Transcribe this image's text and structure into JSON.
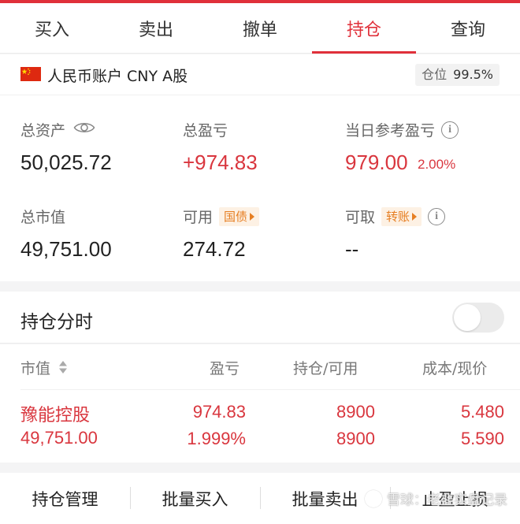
{
  "tabs": [
    {
      "label": "买入",
      "active": false
    },
    {
      "label": "卖出",
      "active": false
    },
    {
      "label": "撤单",
      "active": false
    },
    {
      "label": "持仓",
      "active": true
    },
    {
      "label": "查询",
      "active": false
    }
  ],
  "account": {
    "flag_icon": "china-flag-icon",
    "title": "人民币账户 CNY A股",
    "position_label": "仓位",
    "position_value": "99.5%"
  },
  "metrics": {
    "total_assets_label": "总资产",
    "total_assets_value": "50,025.72",
    "total_pnl_label": "总盈亏",
    "total_pnl_value": "+974.83",
    "daily_pnl_label": "当日参考盈亏",
    "daily_pnl_value": "979.00",
    "daily_pnl_pct": "2.00%",
    "market_value_label": "总市值",
    "market_value_value": "49,751.00",
    "available_label": "可用",
    "available_tag": "国债",
    "available_value": "274.72",
    "withdrawable_label": "可取",
    "withdrawable_tag": "转账",
    "withdrawable_value": "--"
  },
  "time_share": {
    "label": "持仓分时",
    "enabled": false
  },
  "table": {
    "headers": [
      "市值",
      "盈亏",
      "持仓/可用",
      "成本/现价"
    ],
    "rows": [
      {
        "name": "豫能控股",
        "market_value": "49,751.00",
        "pnl": "974.83",
        "pnl_pct": "1.999%",
        "position": "8900",
        "available": "8900",
        "cost": "5.480",
        "price": "5.590"
      }
    ]
  },
  "actions": [
    "持仓管理",
    "批量买入",
    "批量卖出",
    "止盈止损"
  ],
  "watermark": "雪球：老韭实盘记录",
  "colors": {
    "accent": "#e0303a",
    "up": "#d9363e",
    "tag": "#e67e22"
  }
}
